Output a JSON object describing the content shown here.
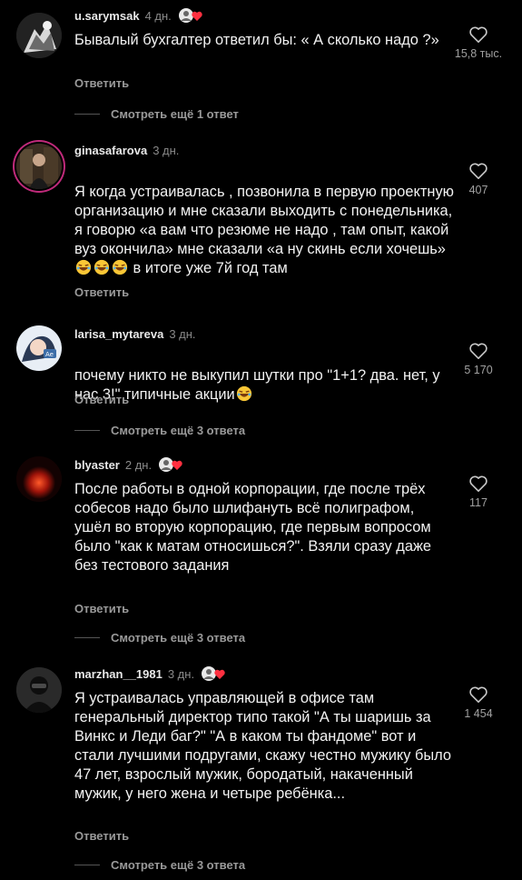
{
  "ui": {
    "reply_label": "Ответить",
    "accent_color": "#c02a7a",
    "heart_icon": "heart-outline-icon"
  },
  "comments": [
    {
      "username": "u.sarymsak",
      "age": "4 дн.",
      "text": "Бывалый бухгалтер ответил бы: « А сколько надо ?»",
      "likes": "15,8 тыс.",
      "liked_by_author": true,
      "more_replies": "Смотреть ещё 1 ответ"
    },
    {
      "username": "ginasafarova",
      "age": "3 дн.",
      "text_before_emoji": "Я когда устраивалась , позвонила в первую проектную организацию и мне сказали выходить с понедельника, я говорю «а вам что резюме не надо , там опыт, какой вуз окончила» мне сказали «а ну скинь если хочешь»",
      "text_after_emoji": " в итоге уже 7й год там",
      "emoji": "😂😂😂",
      "likes": "407",
      "liked_by_author": false,
      "more_replies": ""
    },
    {
      "username": "larisa_mytareva",
      "age": "3 дн.",
      "text_before_emoji": "почему никто не выкупил шутки про \"1+1? два. нет, у нас 3!\" типичные акции",
      "emoji": "😂",
      "likes": "5 170",
      "liked_by_author": false,
      "more_replies": "Смотреть ещё 3 ответа"
    },
    {
      "username": "blyaster",
      "age": "2 дн.",
      "text": "После работы в одной корпорации, где после трёх собесов надо было шлифануть всё полиграфом, ушёл во вторую корпорацию, где первым вопросом было \"как к матам относишься?\". Взяли сразу даже без тестового задания",
      "likes": "117",
      "liked_by_author": true,
      "more_replies": "Смотреть ещё 3 ответа"
    },
    {
      "username": "marzhan__1981",
      "age": "3 дн.",
      "text": "Я устраивалась управляющей в офисе там генеральный директор типо такой \"А ты шаришь за Винкс и Леди баг?\" \"А в каком ты фандоме\" вот и стали лучшими подругами, скажу честно мужику было 47 лет, взрослый мужик, бородатый, накаченный мужик, у него жена и четыре ребёнка...",
      "likes": "1 454",
      "liked_by_author": true,
      "more_replies": "Смотреть ещё 3 ответа"
    }
  ]
}
